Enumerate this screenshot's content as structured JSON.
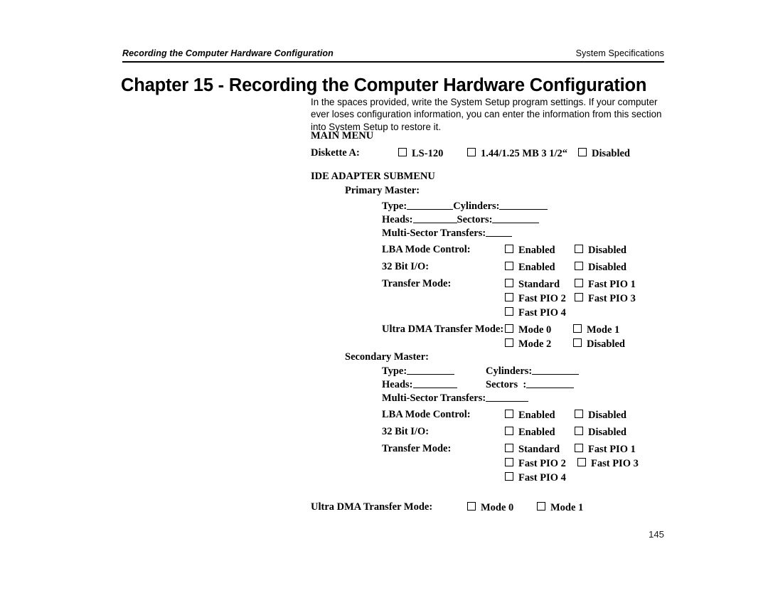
{
  "header": {
    "left": "Recording the Computer Hardware Configuration",
    "right": "System Specifications"
  },
  "title": "Chapter 15 - Recording the Computer Hardware Configuration",
  "intro": "In the spaces provided, write the System Setup program settings. If your computer ever loses configuration information, you can enter the information from this section into System Setup to restore it.",
  "sections": {
    "main_menu": {
      "heading": "MAIN MENU",
      "diskette_a": {
        "label": "Diskette A:",
        "options": [
          "LS-120",
          "1.44/1.25 MB 3 1/2“",
          "Disabled"
        ]
      }
    },
    "ide_adapter": {
      "heading": "IDE ADAPTER SUBMENU",
      "primary_master": {
        "label": "Primary Master:",
        "type_label": "Type:",
        "cylinders_label": "Cylinders:",
        "heads_label": "Heads:",
        "sectors_label": "Sectors:",
        "multi_sector_label": "Multi-Sector Transfers:",
        "lba_label": "LBA Mode Control:",
        "lba_options": [
          "Enabled",
          "Disabled"
        ],
        "bit32_label": "32 Bit I/O:",
        "bit32_options": [
          "Enabled",
          "Disabled"
        ],
        "transfer_label": "Transfer Mode:",
        "transfer_options": [
          "Standard",
          "Fast PIO 1",
          "Fast PIO 2",
          "Fast PIO 3",
          "Fast PIO 4"
        ],
        "udma_label": "Ultra DMA Transfer Mode:",
        "udma_options": [
          "Mode 0",
          "Mode 1",
          "Mode 2",
          "Disabled"
        ]
      },
      "secondary_master": {
        "label": "Secondary Master:",
        "type_label": "Type:",
        "cylinders_label": "Cylinders:",
        "heads_label": "Heads:",
        "sectors_label": "Sectors  :",
        "multi_sector_label": "Multi-Sector Transfers:",
        "lba_label": "LBA Mode Control:",
        "lba_options": [
          "Enabled",
          "Disabled"
        ],
        "bit32_label": "32 Bit I/O:",
        "bit32_options": [
          "Enabled",
          "Disabled"
        ],
        "transfer_label": "Transfer Mode:",
        "transfer_options": [
          "Standard",
          "Fast PIO 1",
          "Fast PIO 2",
          "Fast PIO 3",
          "Fast PIO 4"
        ],
        "udma_label": "Ultra DMA Transfer Mode:",
        "udma_options": [
          "Mode 0",
          "Mode 1"
        ]
      }
    }
  },
  "page_number": "145"
}
